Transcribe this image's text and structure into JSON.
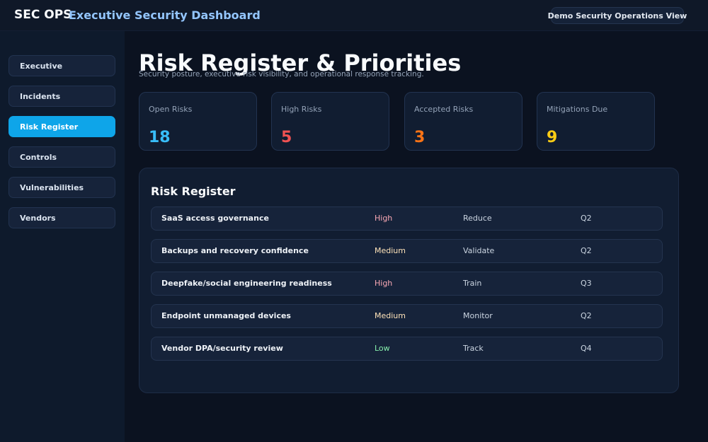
{
  "header": {
    "brand": "SEC OPS",
    "app_title": "Executive Security Dashboard",
    "view_badge": "Demo Security Operations View"
  },
  "sidebar": {
    "items": [
      {
        "label": "Executive",
        "active": false
      },
      {
        "label": "Incidents",
        "active": false
      },
      {
        "label": "Risk Register",
        "active": true
      },
      {
        "label": "Controls",
        "active": false
      },
      {
        "label": "Vulnerabilities",
        "active": false
      },
      {
        "label": "Vendors",
        "active": false
      }
    ]
  },
  "main": {
    "title": "Risk Register & Priorities",
    "subtitle": "Security posture, executive risk visibility, and operational response tracking.",
    "kpis": [
      {
        "label": "Open Risks",
        "value": "18",
        "color": "#38bdf8"
      },
      {
        "label": "High Risks",
        "value": "5",
        "color": "#f05252"
      },
      {
        "label": "Accepted Risks",
        "value": "3",
        "color": "#f97316"
      },
      {
        "label": "Mitigations Due",
        "value": "9",
        "color": "#facc15"
      }
    ],
    "register": {
      "title": "Risk Register",
      "rows": [
        {
          "name": "SaaS access governance",
          "severity": "High",
          "action": "Reduce",
          "due": "Q2"
        },
        {
          "name": "Backups and recovery confidence",
          "severity": "Medium",
          "action": "Validate",
          "due": "Q2"
        },
        {
          "name": "Deepfake/social engineering readiness",
          "severity": "High",
          "action": "Train",
          "due": "Q3"
        },
        {
          "name": "Endpoint unmanaged devices",
          "severity": "Medium",
          "action": "Monitor",
          "due": "Q2"
        },
        {
          "name": "Vendor DPA/security review",
          "severity": "Low",
          "action": "Track",
          "due": "Q4"
        }
      ]
    }
  }
}
